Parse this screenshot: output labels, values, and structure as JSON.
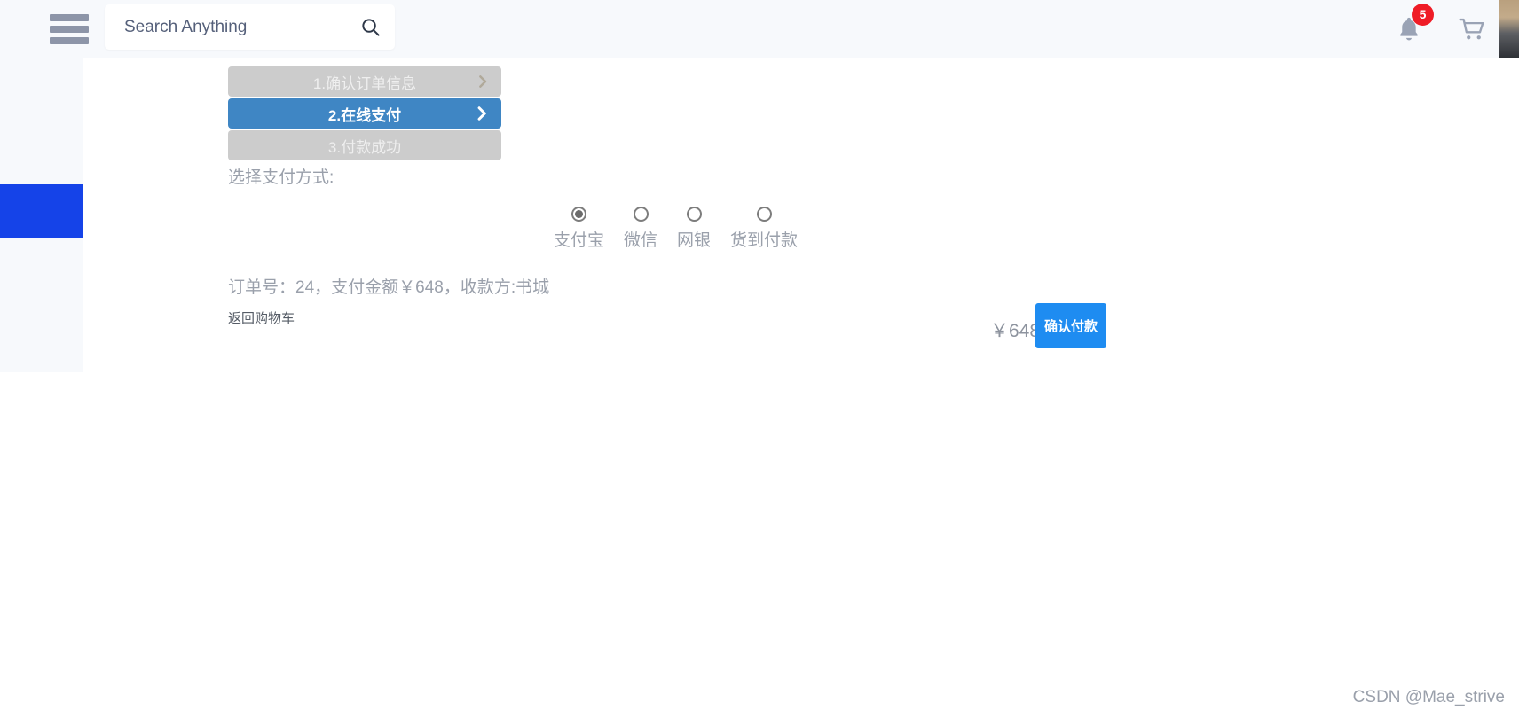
{
  "header": {
    "menu_icon": "hamburger-menu-icon",
    "search": {
      "placeholder": "Search Anything",
      "value": "",
      "icon": "search-icon"
    },
    "notifications": {
      "icon": "bell-icon",
      "badge_count": "5",
      "badge_color": "#ef1c26"
    },
    "cart": {
      "icon": "shopping-cart-icon"
    },
    "avatar": {
      "icon": "user-avatar"
    },
    "background_color": "#f7f9fc"
  },
  "sidebar": {
    "active_indicator_color": "#1543e8",
    "background_color": "#f7f9fc"
  },
  "checkout": {
    "steps": [
      {
        "label": "1.确认订单信息",
        "state": "inactive",
        "chevron": "chevron-right-icon"
      },
      {
        "label": "2.在线支付",
        "state": "active",
        "chevron": "chevron-right-icon"
      },
      {
        "label": "3.付款成功",
        "state": "inactive",
        "chevron": ""
      }
    ],
    "step_inactive_color": "#cccccc",
    "step_active_color": "#3f86c4",
    "choose_payment_label": "选择支付方式:",
    "payment_methods": [
      {
        "label": "支付宝",
        "selected": true
      },
      {
        "label": "微信",
        "selected": false
      },
      {
        "label": "网银",
        "selected": false
      },
      {
        "label": "货到付款",
        "selected": false
      }
    ],
    "order_info": "订单号：24，支付金额￥648，收款方:书城",
    "back_to_cart_label": "返回购物车",
    "total_amount": "￥648",
    "confirm_button_label": "确认付款",
    "confirm_button_color": "#1e8cf1"
  },
  "watermark": {
    "text": "CSDN @Mae_strive"
  }
}
